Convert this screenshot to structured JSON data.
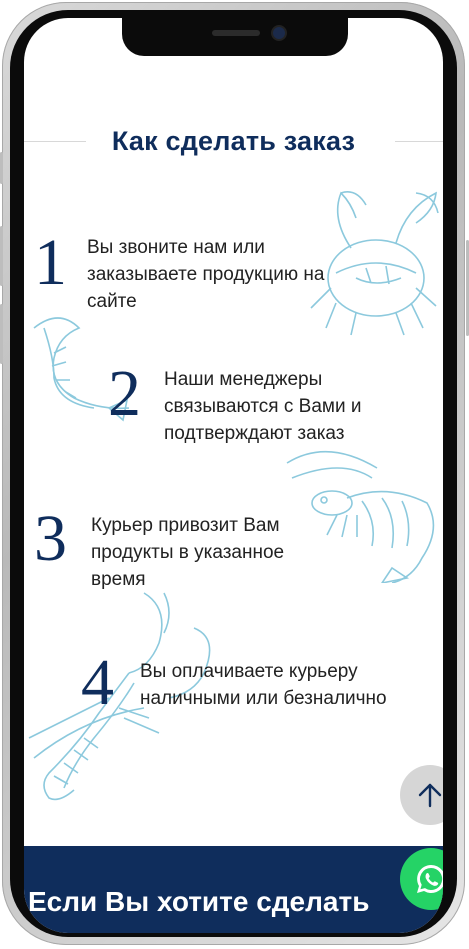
{
  "section": {
    "title": "Как сделать заказ"
  },
  "steps": [
    {
      "number": "1",
      "lines": [
        "Вы звоните нам или",
        "заказываете продукцию на",
        "сайте"
      ]
    },
    {
      "number": "2",
      "lines": [
        "Наши менеджеры",
        "связываются с Вами и",
        "подтверждают заказ"
      ]
    },
    {
      "number": "3",
      "lines": [
        "Курьер привозит Вам",
        "продукты в указанное",
        "время"
      ]
    },
    {
      "number": "4",
      "lines": [
        "Вы оплачиваете курьеру",
        "наличными или безналично"
      ]
    }
  ],
  "cta": {
    "text": "Если Вы хотите сделать"
  },
  "icons": {
    "scroll_up": "arrow-up-icon",
    "whatsapp": "whatsapp-icon",
    "illustrations": [
      "crab-icon",
      "shrimp-icon",
      "prawn-icon",
      "lobster-icon"
    ]
  },
  "colors": {
    "brand_navy": "#0f2d5c",
    "illustration_blue": "#8cc9dd",
    "whatsapp_green": "#25d366",
    "scroll_button": "#d6d6d6"
  }
}
